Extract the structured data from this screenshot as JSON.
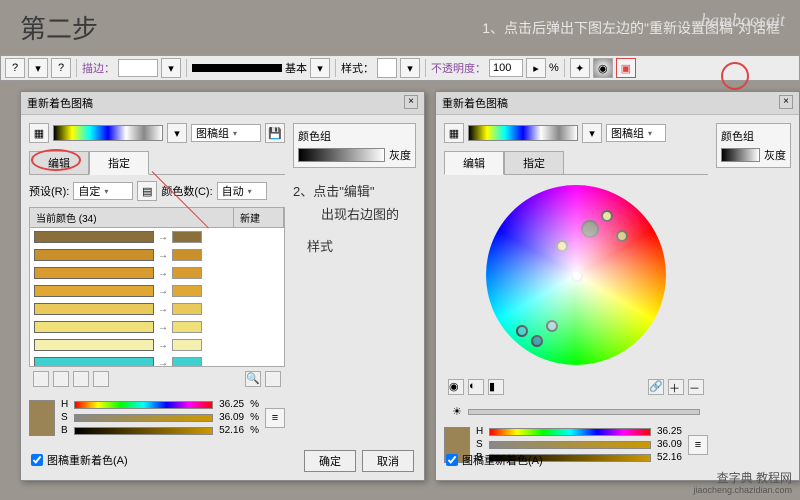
{
  "header": {
    "step_title": "第二步",
    "instruction": "1、点击后弹出下图左边的\"重新设置图稿\"对话框",
    "brand": "bamboosait"
  },
  "toolbar": {
    "stroke_label": "描边：",
    "stroke_value": "",
    "brush_label": "基本",
    "style_label": "样式：",
    "opacity_label": "不透明度：",
    "opacity_value": "100",
    "opacity_unit": "%"
  },
  "dialog": {
    "title": "重新着色图稿",
    "close": "×",
    "tab_edit": "编辑",
    "tab_assign": "指定",
    "preset_label": "预设(R):",
    "preset_value": "自定",
    "colors_label": "颜色数(C):",
    "colors_value": "自动",
    "group_label": "图稿组",
    "colorgroup_label": "颜色组",
    "gray_label": "灰度",
    "current_colors": "当前颜色 (34)",
    "new_col": "新建",
    "swatches": [
      "#8a6f3a",
      "#c98f2a",
      "#d99a2e",
      "#e0a733",
      "#e8c95a",
      "#f0e07a",
      "#f5f0b0",
      "#40d0d0"
    ],
    "hsb": {
      "h_label": "H",
      "h_value": "36.25",
      "s_label": "S",
      "s_value": "36.09",
      "b_label": "B",
      "b_value": "52.16",
      "unit": "%"
    },
    "recolor_check": "图稿重新着色(A)",
    "ok": "确定",
    "cancel": "取消"
  },
  "note": {
    "line1": "2、点击\"编辑\"",
    "line2": "出现右边图的",
    "line3": "样式"
  },
  "watermark": {
    "l1": "查字典 教程网",
    "l2": "jiaocheng.chazidian.com"
  }
}
